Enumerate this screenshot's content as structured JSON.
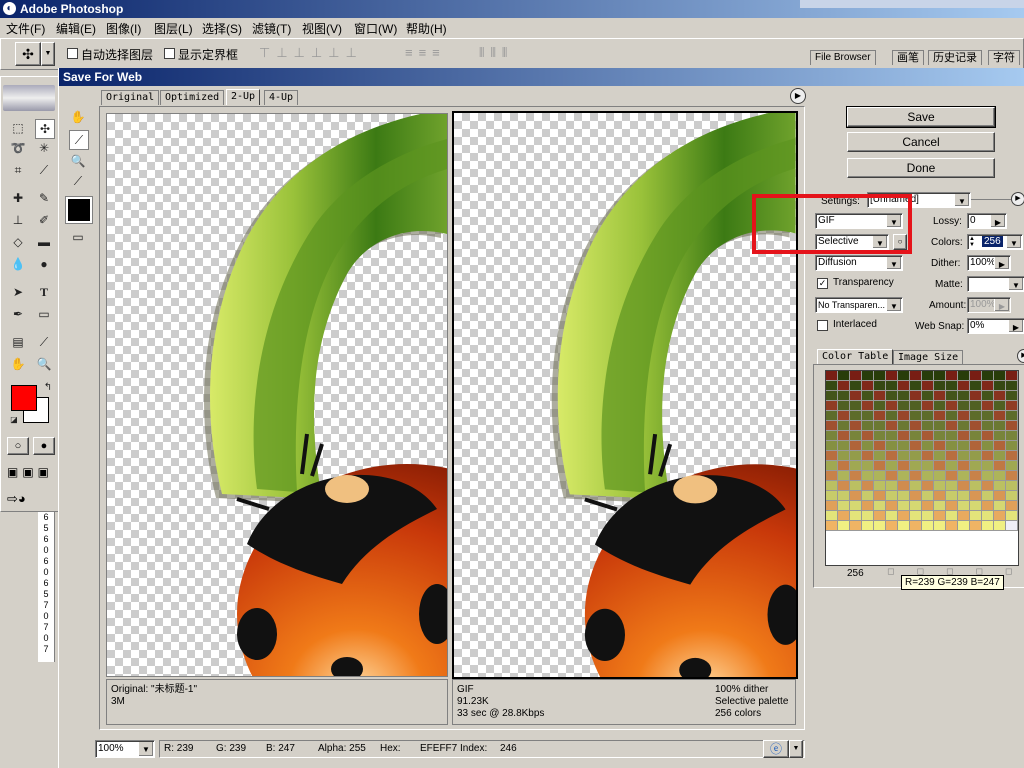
{
  "app": {
    "title": "Adobe Photoshop"
  },
  "menu": [
    "文件(F)",
    "编辑(E)",
    "图像(I)",
    "图层(L)",
    "选择(S)",
    "滤镜(T)",
    "视图(V)",
    "窗口(W)",
    "帮助(H)"
  ],
  "options": {
    "auto_select": "自动选择图层",
    "show_bounds": "显示定界框"
  },
  "palette_tabs": [
    "File Browser",
    "画笔",
    "历史记录",
    "字符"
  ],
  "dialog": {
    "title": "Save For Web"
  },
  "view_tabs": [
    "Original",
    "Optimized",
    "2-Up",
    "4-Up"
  ],
  "buttons": {
    "save": "Save",
    "cancel": "Cancel",
    "done": "Done"
  },
  "settings": {
    "settings_label": "Settings:",
    "settings_value": "[Unnamed]",
    "format": "GIF",
    "lossy_label": "Lossy:",
    "lossy": "0",
    "palette": "Selective",
    "colors_label": "Colors:",
    "colors": "256",
    "dither_algo": "Diffusion",
    "dither_label": "Dither:",
    "dither": "100%",
    "transparency": "Transparency",
    "matte_label": "Matte:",
    "trans_dither": "No Transparen...",
    "amount_label": "Amount:",
    "amount": "100%",
    "interlaced": "Interlaced",
    "websnap_label": "Web Snap:",
    "websnap": "0%"
  },
  "color_tabs": [
    "Color Table",
    "Image Size"
  ],
  "color_table": {
    "count": "256",
    "tooltip": "R=239 G=239 B=247"
  },
  "left_info": {
    "name": "Original: \"未标题-1\"",
    "size": "3M"
  },
  "right_info": {
    "format": "GIF",
    "size": "91.23K",
    "time": "33 sec @ 28.8Kbps",
    "dither": "100% dither",
    "palette": "Selective palette",
    "colors": "256 colors"
  },
  "status": {
    "zoom": "100%",
    "r": "R: 239",
    "g": "G: 239",
    "b": "B: 247",
    "alpha": "Alpha: 255",
    "hex": "Hex:",
    "hexval": "EFEFF7",
    "index": "Index:",
    "indexval": "246"
  },
  "ruler_marks": [
    "6",
    "5",
    "6",
    "0",
    "6",
    "0",
    "6",
    "5",
    "7",
    "0",
    "7",
    "0",
    "7"
  ],
  "colors": {
    "title_bar": "#0a246a",
    "highlight": "#e5131a",
    "foreground": "#ff0000"
  }
}
